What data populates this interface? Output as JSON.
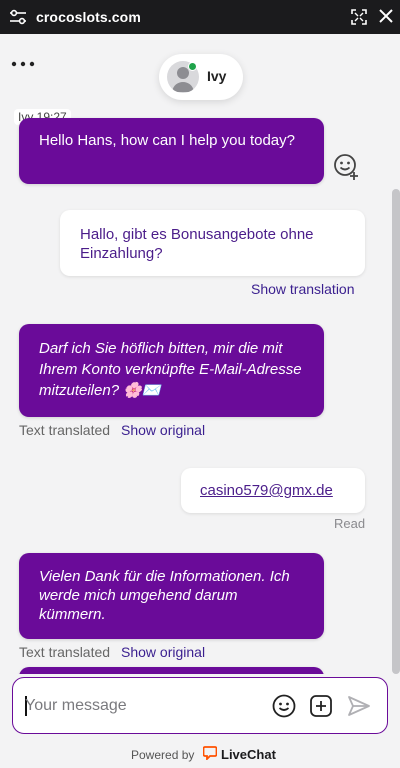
{
  "topbar": {
    "site": "crocoslots.com",
    "icons": {
      "left": "sliders-icon",
      "expand": "expand-icon",
      "close": "close-icon"
    }
  },
  "agent": {
    "name": "Ivy",
    "status_color": "#1fa34a"
  },
  "messages": [
    {
      "author": "agent",
      "meta": "Ivy 19:27",
      "text": "Hello Hans, how can I help you today?"
    },
    {
      "author": "user",
      "text": "Hallo, gibt es Bonusangebote ohne Einzahlung?",
      "action": "Show translation"
    },
    {
      "author": "agent",
      "text": "Darf ich Sie höflich bitten, mir die mit Ihrem Konto verknüpfte E-Mail-Adresse mitzuteilen? 🌸✉️",
      "note": "Text translated",
      "action": "Show original"
    },
    {
      "author": "user",
      "text": "casino579@gmx.de",
      "status": "Read"
    },
    {
      "author": "agent",
      "text": "Vielen Dank für die Informationen. Ich werde mich umgehend darum kümmern.",
      "note": "Text translated",
      "action": "Show original"
    }
  ],
  "composer": {
    "placeholder": "Your message"
  },
  "footer": {
    "powered_by": "Powered by",
    "brand": "LiveChat"
  },
  "colors": {
    "agent_bubble": "#6a0b99",
    "topbar": "#1b1b1d",
    "brand_orange": "#ff5100"
  }
}
